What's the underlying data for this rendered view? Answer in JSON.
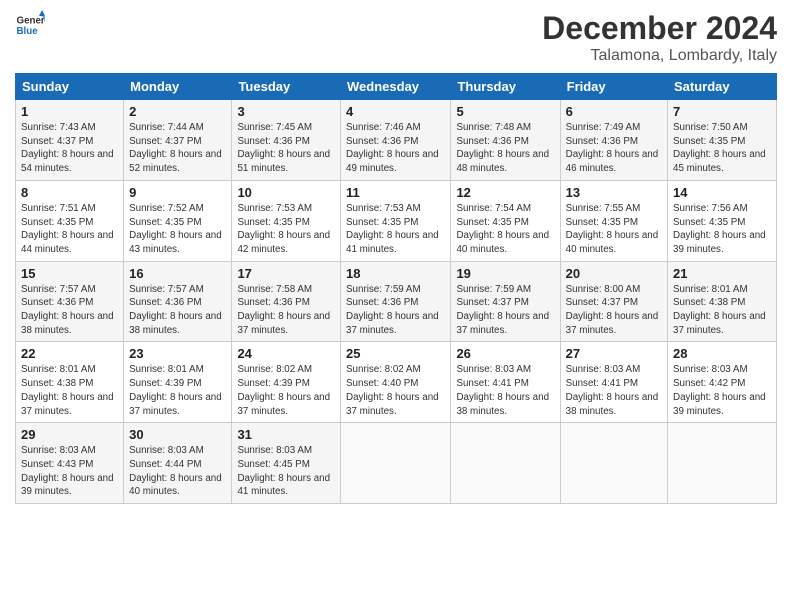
{
  "logo": {
    "line1": "General",
    "line2": "Blue"
  },
  "title": "December 2024",
  "subtitle": "Talamona, Lombardy, Italy",
  "weekdays": [
    "Sunday",
    "Monday",
    "Tuesday",
    "Wednesday",
    "Thursday",
    "Friday",
    "Saturday"
  ],
  "weeks": [
    [
      {
        "day": "1",
        "sunrise": "Sunrise: 7:43 AM",
        "sunset": "Sunset: 4:37 PM",
        "daylight": "Daylight: 8 hours and 54 minutes."
      },
      {
        "day": "2",
        "sunrise": "Sunrise: 7:44 AM",
        "sunset": "Sunset: 4:37 PM",
        "daylight": "Daylight: 8 hours and 52 minutes."
      },
      {
        "day": "3",
        "sunrise": "Sunrise: 7:45 AM",
        "sunset": "Sunset: 4:36 PM",
        "daylight": "Daylight: 8 hours and 51 minutes."
      },
      {
        "day": "4",
        "sunrise": "Sunrise: 7:46 AM",
        "sunset": "Sunset: 4:36 PM",
        "daylight": "Daylight: 8 hours and 49 minutes."
      },
      {
        "day": "5",
        "sunrise": "Sunrise: 7:48 AM",
        "sunset": "Sunset: 4:36 PM",
        "daylight": "Daylight: 8 hours and 48 minutes."
      },
      {
        "day": "6",
        "sunrise": "Sunrise: 7:49 AM",
        "sunset": "Sunset: 4:36 PM",
        "daylight": "Daylight: 8 hours and 46 minutes."
      },
      {
        "day": "7",
        "sunrise": "Sunrise: 7:50 AM",
        "sunset": "Sunset: 4:35 PM",
        "daylight": "Daylight: 8 hours and 45 minutes."
      }
    ],
    [
      {
        "day": "8",
        "sunrise": "Sunrise: 7:51 AM",
        "sunset": "Sunset: 4:35 PM",
        "daylight": "Daylight: 8 hours and 44 minutes."
      },
      {
        "day": "9",
        "sunrise": "Sunrise: 7:52 AM",
        "sunset": "Sunset: 4:35 PM",
        "daylight": "Daylight: 8 hours and 43 minutes."
      },
      {
        "day": "10",
        "sunrise": "Sunrise: 7:53 AM",
        "sunset": "Sunset: 4:35 PM",
        "daylight": "Daylight: 8 hours and 42 minutes."
      },
      {
        "day": "11",
        "sunrise": "Sunrise: 7:53 AM",
        "sunset": "Sunset: 4:35 PM",
        "daylight": "Daylight: 8 hours and 41 minutes."
      },
      {
        "day": "12",
        "sunrise": "Sunrise: 7:54 AM",
        "sunset": "Sunset: 4:35 PM",
        "daylight": "Daylight: 8 hours and 40 minutes."
      },
      {
        "day": "13",
        "sunrise": "Sunrise: 7:55 AM",
        "sunset": "Sunset: 4:35 PM",
        "daylight": "Daylight: 8 hours and 40 minutes."
      },
      {
        "day": "14",
        "sunrise": "Sunrise: 7:56 AM",
        "sunset": "Sunset: 4:35 PM",
        "daylight": "Daylight: 8 hours and 39 minutes."
      }
    ],
    [
      {
        "day": "15",
        "sunrise": "Sunrise: 7:57 AM",
        "sunset": "Sunset: 4:36 PM",
        "daylight": "Daylight: 8 hours and 38 minutes."
      },
      {
        "day": "16",
        "sunrise": "Sunrise: 7:57 AM",
        "sunset": "Sunset: 4:36 PM",
        "daylight": "Daylight: 8 hours and 38 minutes."
      },
      {
        "day": "17",
        "sunrise": "Sunrise: 7:58 AM",
        "sunset": "Sunset: 4:36 PM",
        "daylight": "Daylight: 8 hours and 37 minutes."
      },
      {
        "day": "18",
        "sunrise": "Sunrise: 7:59 AM",
        "sunset": "Sunset: 4:36 PM",
        "daylight": "Daylight: 8 hours and 37 minutes."
      },
      {
        "day": "19",
        "sunrise": "Sunrise: 7:59 AM",
        "sunset": "Sunset: 4:37 PM",
        "daylight": "Daylight: 8 hours and 37 minutes."
      },
      {
        "day": "20",
        "sunrise": "Sunrise: 8:00 AM",
        "sunset": "Sunset: 4:37 PM",
        "daylight": "Daylight: 8 hours and 37 minutes."
      },
      {
        "day": "21",
        "sunrise": "Sunrise: 8:01 AM",
        "sunset": "Sunset: 4:38 PM",
        "daylight": "Daylight: 8 hours and 37 minutes."
      }
    ],
    [
      {
        "day": "22",
        "sunrise": "Sunrise: 8:01 AM",
        "sunset": "Sunset: 4:38 PM",
        "daylight": "Daylight: 8 hours and 37 minutes."
      },
      {
        "day": "23",
        "sunrise": "Sunrise: 8:01 AM",
        "sunset": "Sunset: 4:39 PM",
        "daylight": "Daylight: 8 hours and 37 minutes."
      },
      {
        "day": "24",
        "sunrise": "Sunrise: 8:02 AM",
        "sunset": "Sunset: 4:39 PM",
        "daylight": "Daylight: 8 hours and 37 minutes."
      },
      {
        "day": "25",
        "sunrise": "Sunrise: 8:02 AM",
        "sunset": "Sunset: 4:40 PM",
        "daylight": "Daylight: 8 hours and 37 minutes."
      },
      {
        "day": "26",
        "sunrise": "Sunrise: 8:03 AM",
        "sunset": "Sunset: 4:41 PM",
        "daylight": "Daylight: 8 hours and 38 minutes."
      },
      {
        "day": "27",
        "sunrise": "Sunrise: 8:03 AM",
        "sunset": "Sunset: 4:41 PM",
        "daylight": "Daylight: 8 hours and 38 minutes."
      },
      {
        "day": "28",
        "sunrise": "Sunrise: 8:03 AM",
        "sunset": "Sunset: 4:42 PM",
        "daylight": "Daylight: 8 hours and 39 minutes."
      }
    ],
    [
      {
        "day": "29",
        "sunrise": "Sunrise: 8:03 AM",
        "sunset": "Sunset: 4:43 PM",
        "daylight": "Daylight: 8 hours and 39 minutes."
      },
      {
        "day": "30",
        "sunrise": "Sunrise: 8:03 AM",
        "sunset": "Sunset: 4:44 PM",
        "daylight": "Daylight: 8 hours and 40 minutes."
      },
      {
        "day": "31",
        "sunrise": "Sunrise: 8:03 AM",
        "sunset": "Sunset: 4:45 PM",
        "daylight": "Daylight: 8 hours and 41 minutes."
      },
      null,
      null,
      null,
      null
    ]
  ]
}
